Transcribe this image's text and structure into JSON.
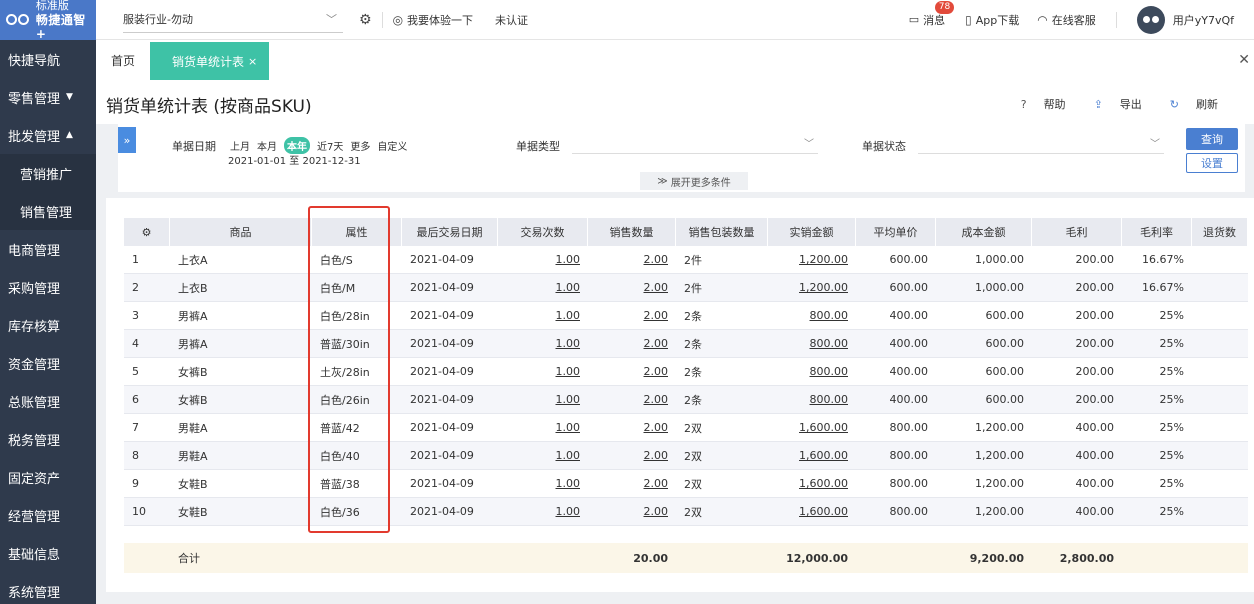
{
  "logo": {
    "edition": "标准版",
    "brand": "畅捷通智+"
  },
  "sidebar": {
    "items": [
      {
        "label": "快捷导航",
        "arrow": ""
      },
      {
        "label": "零售管理",
        "arrow": "▼"
      },
      {
        "label": "批发管理",
        "arrow": "▲"
      },
      {
        "label": "营销推广",
        "arrow": "",
        "sub": true
      },
      {
        "label": "销售管理",
        "arrow": "",
        "sub": true
      },
      {
        "label": "电商管理",
        "arrow": ""
      },
      {
        "label": "采购管理",
        "arrow": ""
      },
      {
        "label": "库存核算",
        "arrow": ""
      },
      {
        "label": "资金管理",
        "arrow": ""
      },
      {
        "label": "总账管理",
        "arrow": ""
      },
      {
        "label": "税务管理",
        "arrow": ""
      },
      {
        "label": "固定资产",
        "arrow": ""
      },
      {
        "label": "经营管理",
        "arrow": ""
      },
      {
        "label": "基础信息",
        "arrow": ""
      },
      {
        "label": "系统管理",
        "arrow": ""
      }
    ]
  },
  "topbar": {
    "industry": "服装行业-勿动",
    "experience": "我要体验一下",
    "cert_status": "未认证",
    "messages": "消息",
    "message_count": "78",
    "app_download": "App下载",
    "online_service": "在线客服",
    "username": "用户yY7vQf"
  },
  "tabs": {
    "home": "首页",
    "active": "销货单统计表",
    "close": "×"
  },
  "page": {
    "title": "销货单统计表 (按商品SKU)",
    "help": "帮助",
    "export": "导出",
    "refresh": "刷新"
  },
  "filter": {
    "date_label": "单据日期",
    "date_options": [
      "上月",
      "本月",
      "本年",
      "近7天",
      "更多",
      "自定义"
    ],
    "date_selected": "本年",
    "date_range": "2021-01-01 至 2021-12-31",
    "type_label": "单据类型",
    "status_label": "单据状态",
    "query_btn": "查询",
    "settings_btn": "设置",
    "more_conditions": "展开更多条件"
  },
  "table": {
    "headers": [
      "商品",
      "属性",
      "最后交易日期",
      "交易次数",
      "销售数量",
      "销售包装数量",
      "实销金额",
      "平均单价",
      "成本金额",
      "毛利",
      "毛利率",
      "退货数"
    ],
    "rows": [
      {
        "no": "1",
        "product": "上衣A",
        "attr": "白色/S",
        "date": "2021-04-09",
        "count": "1.00",
        "qty": "2.00",
        "pkg": "2件",
        "amount": "1,200.00",
        "price": "600.00",
        "cost": "1,000.00",
        "profit": "200.00",
        "rate": "16.67%"
      },
      {
        "no": "2",
        "product": "上衣B",
        "attr": "白色/M",
        "date": "2021-04-09",
        "count": "1.00",
        "qty": "2.00",
        "pkg": "2件",
        "amount": "1,200.00",
        "price": "600.00",
        "cost": "1,000.00",
        "profit": "200.00",
        "rate": "16.67%"
      },
      {
        "no": "3",
        "product": "男裤A",
        "attr": "白色/28in",
        "date": "2021-04-09",
        "count": "1.00",
        "qty": "2.00",
        "pkg": "2条",
        "amount": "800.00",
        "price": "400.00",
        "cost": "600.00",
        "profit": "200.00",
        "rate": "25%"
      },
      {
        "no": "4",
        "product": "男裤A",
        "attr": "普蓝/30in",
        "date": "2021-04-09",
        "count": "1.00",
        "qty": "2.00",
        "pkg": "2条",
        "amount": "800.00",
        "price": "400.00",
        "cost": "600.00",
        "profit": "200.00",
        "rate": "25%"
      },
      {
        "no": "5",
        "product": "女裤B",
        "attr": "土灰/28in",
        "date": "2021-04-09",
        "count": "1.00",
        "qty": "2.00",
        "pkg": "2条",
        "amount": "800.00",
        "price": "400.00",
        "cost": "600.00",
        "profit": "200.00",
        "rate": "25%"
      },
      {
        "no": "6",
        "product": "女裤B",
        "attr": "白色/26in",
        "date": "2021-04-09",
        "count": "1.00",
        "qty": "2.00",
        "pkg": "2条",
        "amount": "800.00",
        "price": "400.00",
        "cost": "600.00",
        "profit": "200.00",
        "rate": "25%"
      },
      {
        "no": "7",
        "product": "男鞋A",
        "attr": "普蓝/42",
        "date": "2021-04-09",
        "count": "1.00",
        "qty": "2.00",
        "pkg": "2双",
        "amount": "1,600.00",
        "price": "800.00",
        "cost": "1,200.00",
        "profit": "400.00",
        "rate": "25%"
      },
      {
        "no": "8",
        "product": "男鞋A",
        "attr": "白色/40",
        "date": "2021-04-09",
        "count": "1.00",
        "qty": "2.00",
        "pkg": "2双",
        "amount": "1,600.00",
        "price": "800.00",
        "cost": "1,200.00",
        "profit": "400.00",
        "rate": "25%"
      },
      {
        "no": "9",
        "product": "女鞋B",
        "attr": "普蓝/38",
        "date": "2021-04-09",
        "count": "1.00",
        "qty": "2.00",
        "pkg": "2双",
        "amount": "1,600.00",
        "price": "800.00",
        "cost": "1,200.00",
        "profit": "400.00",
        "rate": "25%"
      },
      {
        "no": "10",
        "product": "女鞋B",
        "attr": "白色/36",
        "date": "2021-04-09",
        "count": "1.00",
        "qty": "2.00",
        "pkg": "2双",
        "amount": "1,600.00",
        "price": "800.00",
        "cost": "1,200.00",
        "profit": "400.00",
        "rate": "25%"
      }
    ],
    "total": {
      "label": "合计",
      "qty": "20.00",
      "amount": "12,000.00",
      "cost": "9,200.00",
      "profit": "2,800.00"
    }
  },
  "colors": {
    "accent": "#3ec2a6",
    "primary": "#4a7fd1",
    "sidebar": "#2f3a4c",
    "highlight": "#e23a2e"
  }
}
